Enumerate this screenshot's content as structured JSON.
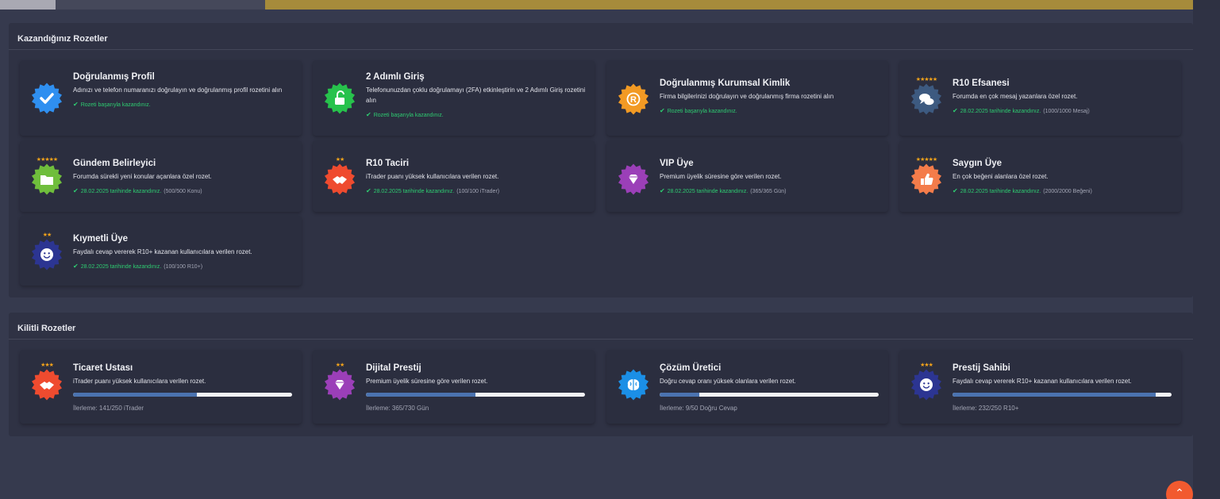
{
  "earned": {
    "title": "Kazandığınız Rozetler",
    "badges": [
      {
        "title": "Doğrulanmış Profil",
        "desc": "Adınızı ve telefon numaranızı doğrulayın ve doğrulanmış profil rozetini alın",
        "status": "Rozeti başarıyla kazandınız.",
        "extra": "",
        "stars": "",
        "icon": "checkmark-icon",
        "color": "#2f8ff0"
      },
      {
        "title": "2 Adımlı Giriş",
        "desc": "Telefonunuzdan çoklu doğrulamayı (2FA) etkinleştirin ve 2 Adımlı Giriş rozetini alın",
        "status": "Rozeti başarıyla kazandınız.",
        "extra": "",
        "stars": "",
        "icon": "unlock-icon",
        "color": "#27c24c"
      },
      {
        "title": "Doğrulanmış Kurumsal Kimlik",
        "desc": "Firma bilgilerinizi doğrulayın ve doğrulanmış firma rozetini alın",
        "status": "Rozeti başarıyla kazandınız.",
        "extra": "",
        "stars": "",
        "icon": "registered-icon",
        "color": "#f29a24"
      },
      {
        "title": "R10 Efsanesi",
        "desc": "Forumda en çok mesaj yazanlara özel rozet.",
        "status": "28.02.2025 tarihinde kazandınız.",
        "extra": "(1000/1000 Mesaj)",
        "stars": "★★★★★",
        "icon": "chat-bubbles-icon",
        "color": "#3d5a80"
      },
      {
        "title": "Gündem Belirleyici",
        "desc": "Forumda sürekli yeni konular açanlara özel rozet.",
        "status": "28.02.2025 tarihinde kazandınız.",
        "extra": "(500/500 Konu)",
        "stars": "★★★★★",
        "icon": "folder-icon",
        "color": "#6fbe3c"
      },
      {
        "title": "R10 Taciri",
        "desc": "iTrader puanı yüksek kullanıcılara verilen rozet.",
        "status": "28.02.2025 tarihinde kazandınız.",
        "extra": "(100/100 iTrader)",
        "stars": "★★",
        "icon": "handshake-icon",
        "color": "#ef4b2f"
      },
      {
        "title": "VIP Üye",
        "desc": "Premium üyelik süresine göre verilen rozet.",
        "status": "28.02.2025 tarihinde kazandınız.",
        "extra": "(365/365 Gün)",
        "stars": "",
        "icon": "diamond-icon",
        "color": "#9b3fb8"
      },
      {
        "title": "Saygın Üye",
        "desc": "En çok beğeni alanlara özel rozet.",
        "status": "28.02.2025 tarihinde kazandınız.",
        "extra": "(2000/2000 Beğeni)",
        "stars": "★★★★★",
        "icon": "thumbs-up-icon",
        "color": "#f47c4a"
      },
      {
        "title": "Kıymetli Üye",
        "desc": "Faydalı cevap vererek R10+ kazanan kullanıcılara verilen rozet.",
        "status": "28.02.2025 tarihinde kazandınız.",
        "extra": "(100/100 R10+)",
        "stars": "★★",
        "icon": "smiley-icon",
        "color": "#2c3592"
      }
    ]
  },
  "locked": {
    "title": "Kilitli Rozetler",
    "badges": [
      {
        "title": "Ticaret Ustası",
        "desc": "iTrader puanı yüksek kullanıcılara verilen rozet.",
        "progress_text": "İlerleme: 141/250 iTrader",
        "progress": 0.564,
        "stars": "★★★",
        "icon": "handshake-icon",
        "color": "#ef4b2f"
      },
      {
        "title": "Dijital Prestij",
        "desc": "Premium üyelik süresine göre verilen rozet.",
        "progress_text": "İlerleme: 365/730 Gün",
        "progress": 0.5,
        "stars": "★★",
        "icon": "diamond-icon",
        "color": "#9b3fb8"
      },
      {
        "title": "Çözüm Üretici",
        "desc": "Doğru cevap oranı yüksek olanlara verilen rozet.",
        "progress_text": "İlerleme: 9/50 Doğru Cevap",
        "progress": 0.18,
        "stars": "",
        "icon": "brain-icon",
        "color": "#1b8fe6"
      },
      {
        "title": "Prestij Sahibi",
        "desc": "Faydalı cevap vererek R10+ kazanan kullanıcılara verilen rozet.",
        "progress_text": "İlerleme: 232/250 R10+",
        "progress": 0.928,
        "stars": "★★★",
        "icon": "smiley-icon",
        "color": "#2c3592"
      }
    ]
  },
  "scroll_top": {
    "icon": "chevron-up-icon",
    "symbol": "⌃"
  }
}
